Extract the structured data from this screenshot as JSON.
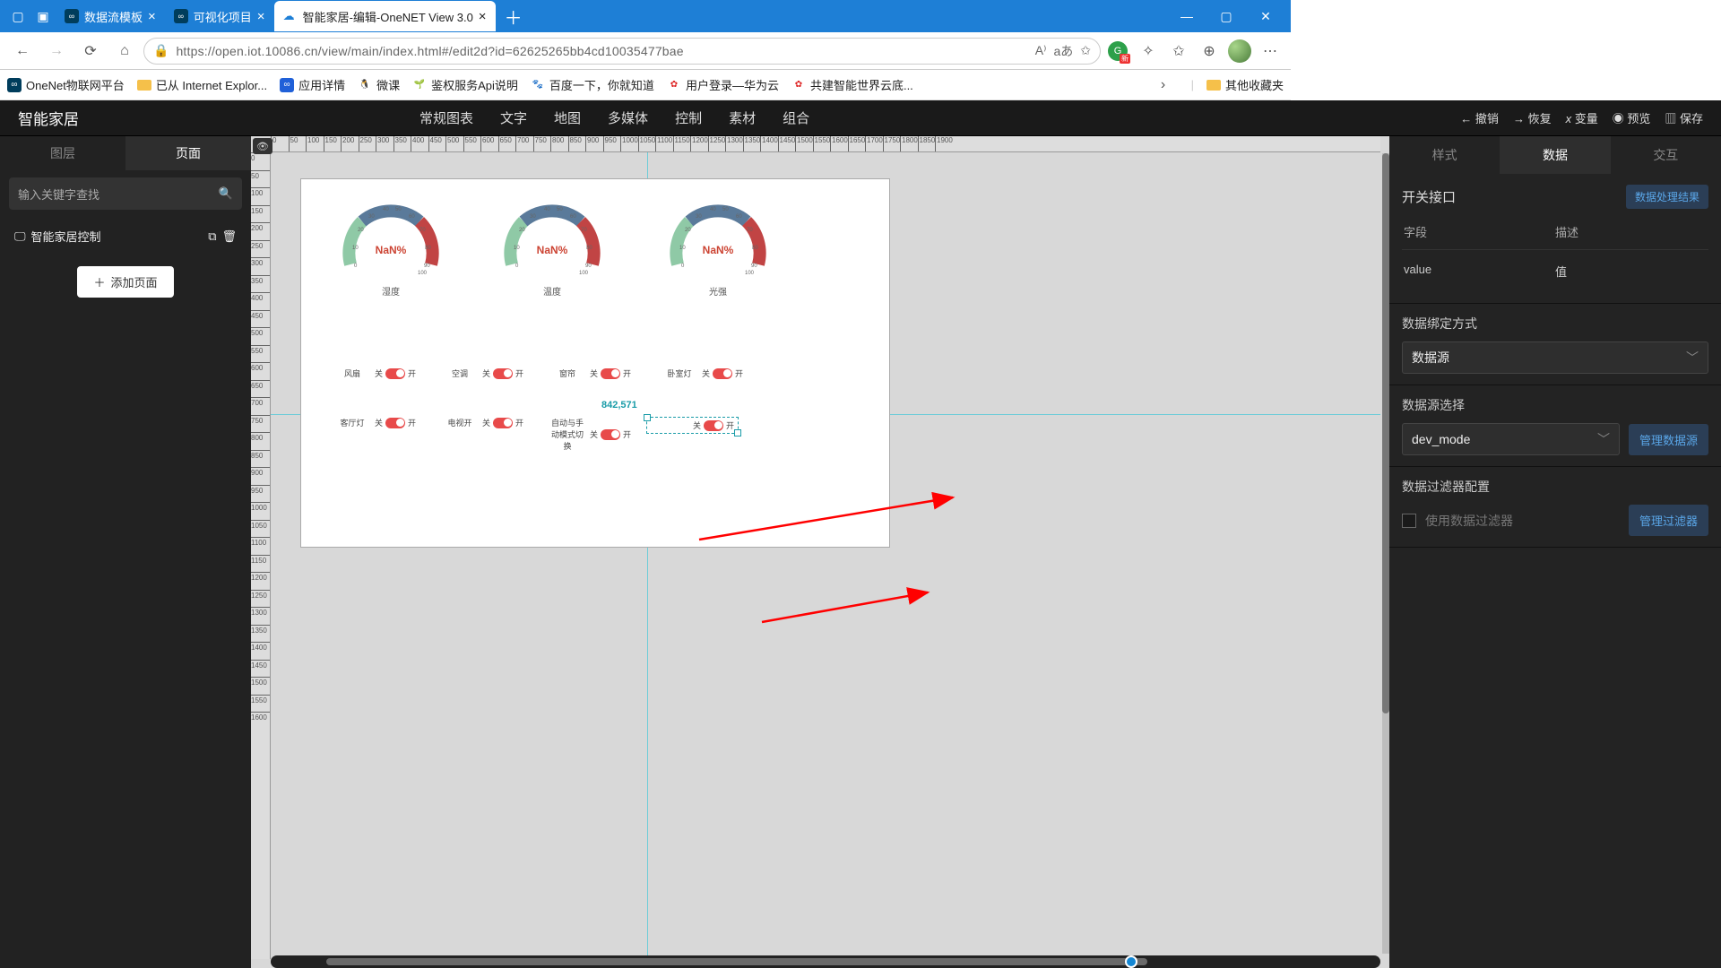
{
  "browser": {
    "tabs": [
      {
        "title": "数据流模板"
      },
      {
        "title": "可视化项目"
      },
      {
        "title": "智能家居-编辑-OneNET View 3.0",
        "active": true
      }
    ],
    "url": "https://open.iot.10086.cn/view/main/index.html#/edit2d?id=62625265bb4cd10035477bae"
  },
  "bookmarks": [
    "OneNet物联网平台",
    "已从 Internet Explor...",
    "应用详情",
    "微课",
    "鉴权服务Api说明",
    "百度一下，你就知道",
    "用户登录—华为云",
    "共建智能世界云底..."
  ],
  "bookmarks_more": "其他收藏夹",
  "app": {
    "title": "智能家居",
    "menu": [
      "常规图表",
      "文字",
      "地图",
      "多媒体",
      "控制",
      "素材",
      "组合"
    ],
    "top_actions": {
      "undo": "撤销",
      "redo": "恢复",
      "var": "变量",
      "preview": "预览",
      "save": "保存"
    }
  },
  "left": {
    "tabs": {
      "layers": "图层",
      "pages": "页面",
      "active": "pages"
    },
    "search_placeholder": "输入关键字查找",
    "page_item": "智能家居控制",
    "add_page": "添加页面"
  },
  "canvas": {
    "gauges": [
      {
        "value": "NaN%",
        "label": "湿度"
      },
      {
        "value": "NaN%",
        "label": "温度"
      },
      {
        "value": "NaN%",
        "label": "光强"
      }
    ],
    "switches_row1": [
      {
        "name": "风扇",
        "off": "关",
        "on": "开"
      },
      {
        "name": "空调",
        "off": "关",
        "on": "开"
      },
      {
        "name": "窗帘",
        "off": "关",
        "on": "开"
      },
      {
        "name": "卧室灯",
        "off": "关",
        "on": "开"
      }
    ],
    "switches_row2": [
      {
        "name": "客厅灯",
        "off": "关",
        "on": "开"
      },
      {
        "name": "电视开",
        "off": "关",
        "on": "开"
      },
      {
        "name": "自动与手动模式切换",
        "off": "关",
        "on": "开"
      },
      {
        "name": "",
        "off": "关",
        "on": "开",
        "selected": true
      }
    ],
    "sel_coord": "842,571",
    "ruler_h": [
      0,
      50,
      100,
      150,
      200,
      250,
      300,
      350,
      400,
      450,
      500,
      550,
      600,
      650,
      700,
      750,
      800,
      850,
      900,
      950,
      1000,
      1050,
      1100,
      1150,
      1200,
      1250,
      1300,
      1350,
      1400,
      1450,
      1500,
      1550,
      1600,
      1650,
      1700,
      1750,
      1800,
      1850,
      1900
    ],
    "ruler_v": [
      0,
      50,
      100,
      150,
      200,
      250,
      300,
      350,
      400,
      450,
      500,
      550,
      600,
      650,
      700,
      750,
      800,
      850,
      900,
      950,
      1000,
      1050,
      1100,
      1150,
      1200,
      1250,
      1300,
      1350,
      1400,
      1450,
      1500,
      1550,
      1600
    ]
  },
  "right": {
    "tabs": {
      "style": "样式",
      "data": "数据",
      "inter": "交互",
      "active": "data"
    },
    "switch_iface": "开关接口",
    "data_result_btn": "数据处理结果",
    "cols": {
      "field": "字段",
      "desc": "描述"
    },
    "row": {
      "field": "value",
      "desc": "值"
    },
    "bind_mode_label": "数据绑定方式",
    "bind_mode_value": "数据源",
    "ds_select_label": "数据源选择",
    "ds_value": "dev_mode",
    "manage_ds": "管理数据源",
    "filter_label": "数据过滤器配置",
    "use_filter": "使用数据过滤器",
    "manage_filter": "管理过滤器"
  }
}
